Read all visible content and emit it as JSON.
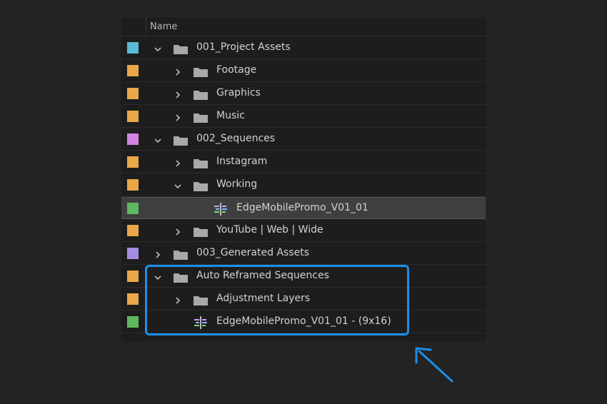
{
  "header": {
    "name_label": "Name"
  },
  "colors": {
    "cyan": "#5bbad6",
    "orange": "#e8a84a",
    "violet": "#d284e0",
    "green": "#5fb85f",
    "lavender": "#a48ce0",
    "accent": "#1e8fe6"
  },
  "rows": [
    {
      "label": "001_Project Assets",
      "type": "folder",
      "expanded": true,
      "color": "#5bbad6",
      "depth": 0
    },
    {
      "label": "Footage",
      "type": "folder",
      "expanded": false,
      "color": "#e8a84a",
      "depth": 1
    },
    {
      "label": "Graphics",
      "type": "folder",
      "expanded": false,
      "color": "#e8a84a",
      "depth": 1
    },
    {
      "label": "Music",
      "type": "folder",
      "expanded": false,
      "color": "#e8a84a",
      "depth": 1
    },
    {
      "label": "002_Sequences",
      "type": "folder",
      "expanded": true,
      "color": "#d284e0",
      "depth": 0
    },
    {
      "label": "Instagram",
      "type": "folder",
      "expanded": false,
      "color": "#e8a84a",
      "depth": 1
    },
    {
      "label": "Working",
      "type": "folder",
      "expanded": true,
      "color": "#e8a84a",
      "depth": 1
    },
    {
      "label": "EdgeMobilePromo_V01_01",
      "type": "sequence",
      "color": "#5fb85f",
      "depth": 2,
      "selected": true
    },
    {
      "label": "YouTube | Web | Wide",
      "type": "folder",
      "expanded": false,
      "color": "#e8a84a",
      "depth": 1
    },
    {
      "label": "003_Generated Assets",
      "type": "folder",
      "expanded": false,
      "color": "#a48ce0",
      "depth": 0
    },
    {
      "label": "Auto Reframed Sequences",
      "type": "folder",
      "expanded": true,
      "color": "#e8a84a",
      "depth": 0
    },
    {
      "label": "Adjustment Layers",
      "type": "folder",
      "expanded": false,
      "color": "#e8a84a",
      "depth": 1
    },
    {
      "label": "EdgeMobilePromo_V01_01 - (9x16)",
      "type": "sequence",
      "color": "#5fb85f",
      "depth": 1
    }
  ]
}
